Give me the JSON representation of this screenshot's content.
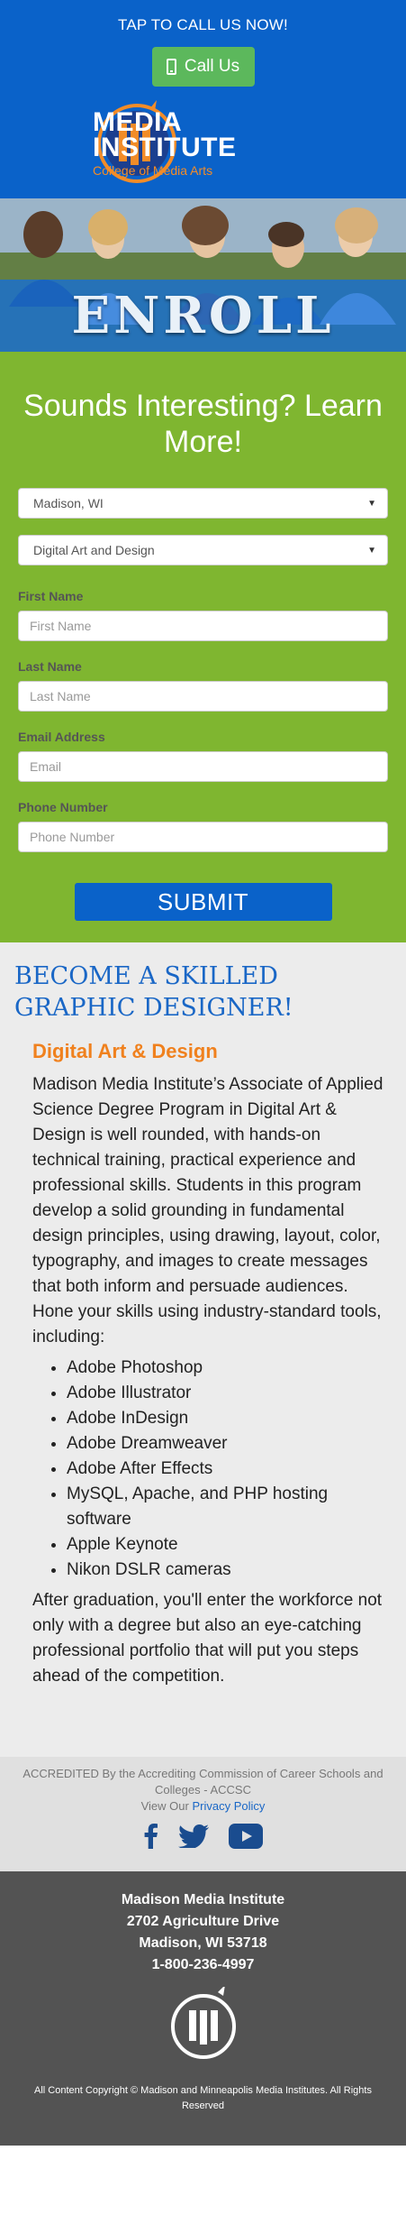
{
  "header": {
    "tap_text": "TAP TO CALL US NOW!",
    "call_label": "Call Us",
    "logo": {
      "line1": "MEDIA",
      "line2": "INSTITUTE",
      "line3": "College of Media Arts"
    }
  },
  "hero": {
    "banner": "ENROLL"
  },
  "form": {
    "heading": "Sounds Interesting? Learn More!",
    "campus_value": "Madison, WI",
    "program_value": "Digital Art and Design",
    "first_name_label": "First Name",
    "first_name_placeholder": "First Name",
    "last_name_label": "Last Name",
    "last_name_placeholder": "Last Name",
    "email_label": "Email Address",
    "email_placeholder": "Email",
    "phone_label": "Phone Number",
    "phone_placeholder": "Phone Number",
    "submit_label": "SUBMIT"
  },
  "content": {
    "title": "BECOME A SKILLED GRAPHIC DESIGNER!",
    "subtitle": "Digital Art & Design",
    "description": "Madison Media Institute’s Associate of Applied Science Degree Program in Digital Art & Design is well rounded, with hands-on technical training, practical experience and professional skills. Students in this program develop a solid grounding in fundamental design principles, using drawing, layout, color, typography, and images to create messages that both inform and persuade audiences. Hone your skills using industry-standard tools, including:",
    "tools": [
      "Adobe Photoshop",
      "Adobe Illustrator",
      "Adobe InDesign",
      "Adobe Dreamweaver",
      "Adobe After Effects",
      "MySQL, Apache, and PHP hosting software",
      "Apple Keynote",
      "Nikon DSLR cameras"
    ],
    "after": "After graduation, you'll enter the workforce not only with a degree but also an eye-catching professional portfolio that will put you steps ahead of the competition."
  },
  "accreditation": {
    "text": "ACCREDITED By the Accrediting Commission of Career Schools and Colleges - ACCSC",
    "view_our": "View Our",
    "privacy_link": "Privacy Policy",
    "social_icons": [
      "facebook-icon",
      "twitter-icon",
      "youtube-icon"
    ]
  },
  "footer": {
    "name": "Madison Media Institute",
    "street": "2702 Agriculture Drive",
    "city": "Madison, WI 53718",
    "phone": "1-800-236-4997",
    "copyright": "All Content Copyright © Madison and Minneapolis Media Institutes. All Rights Reserved"
  },
  "colors": {
    "header_blue": "#0a62c9",
    "call_green": "#5cb85c",
    "form_green": "#7fb630",
    "accent_orange": "#f0811e",
    "footer_gray": "#535353"
  }
}
